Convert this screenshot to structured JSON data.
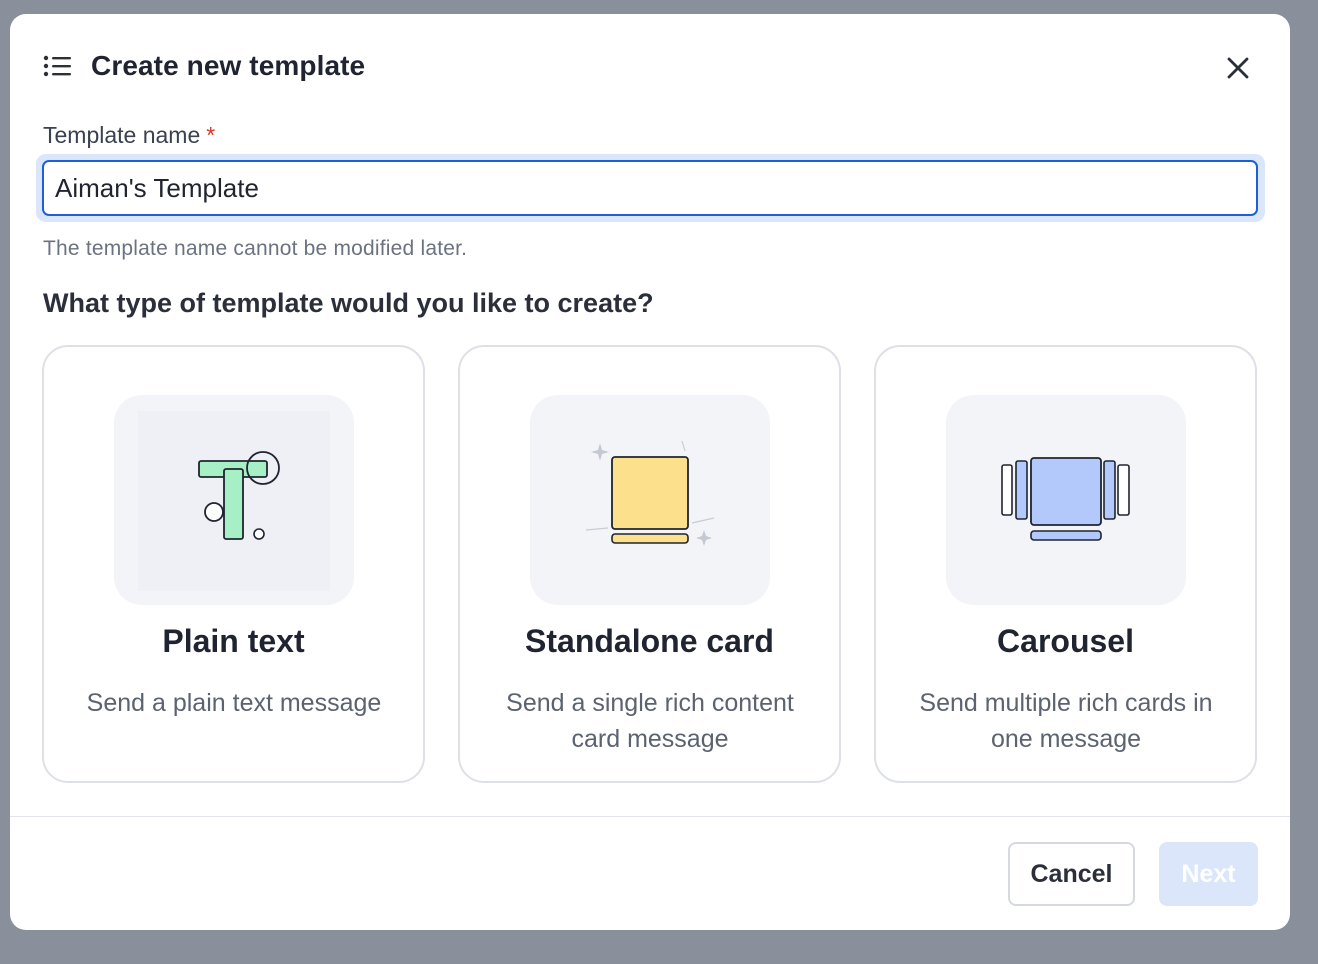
{
  "dialog": {
    "title": "Create new template",
    "title_icon": "list-icon",
    "close_icon": "close-icon"
  },
  "form": {
    "name_label": "Template name",
    "required_marker": "*",
    "name_value": "Aiman's Template",
    "hint": "The template name cannot be modified later."
  },
  "question": "What type of template would you like to create?",
  "options": [
    {
      "title": "Plain text",
      "description": "Send a plain text message",
      "icon": "plain-text-icon",
      "accent": "#a7f0c6"
    },
    {
      "title": "Standalone card",
      "description": "Send a single rich content card message",
      "icon": "standalone-card-icon",
      "accent": "#fde08b"
    },
    {
      "title": "Carousel",
      "description": "Send multiple rich cards in one message",
      "icon": "carousel-icon",
      "accent": "#b3c9fb"
    }
  ],
  "footer": {
    "cancel_label": "Cancel",
    "next_label": "Next"
  },
  "colors": {
    "primary": "#1f5fd6",
    "required": "#d2372b",
    "next_disabled_bg": "#dce6fb"
  }
}
